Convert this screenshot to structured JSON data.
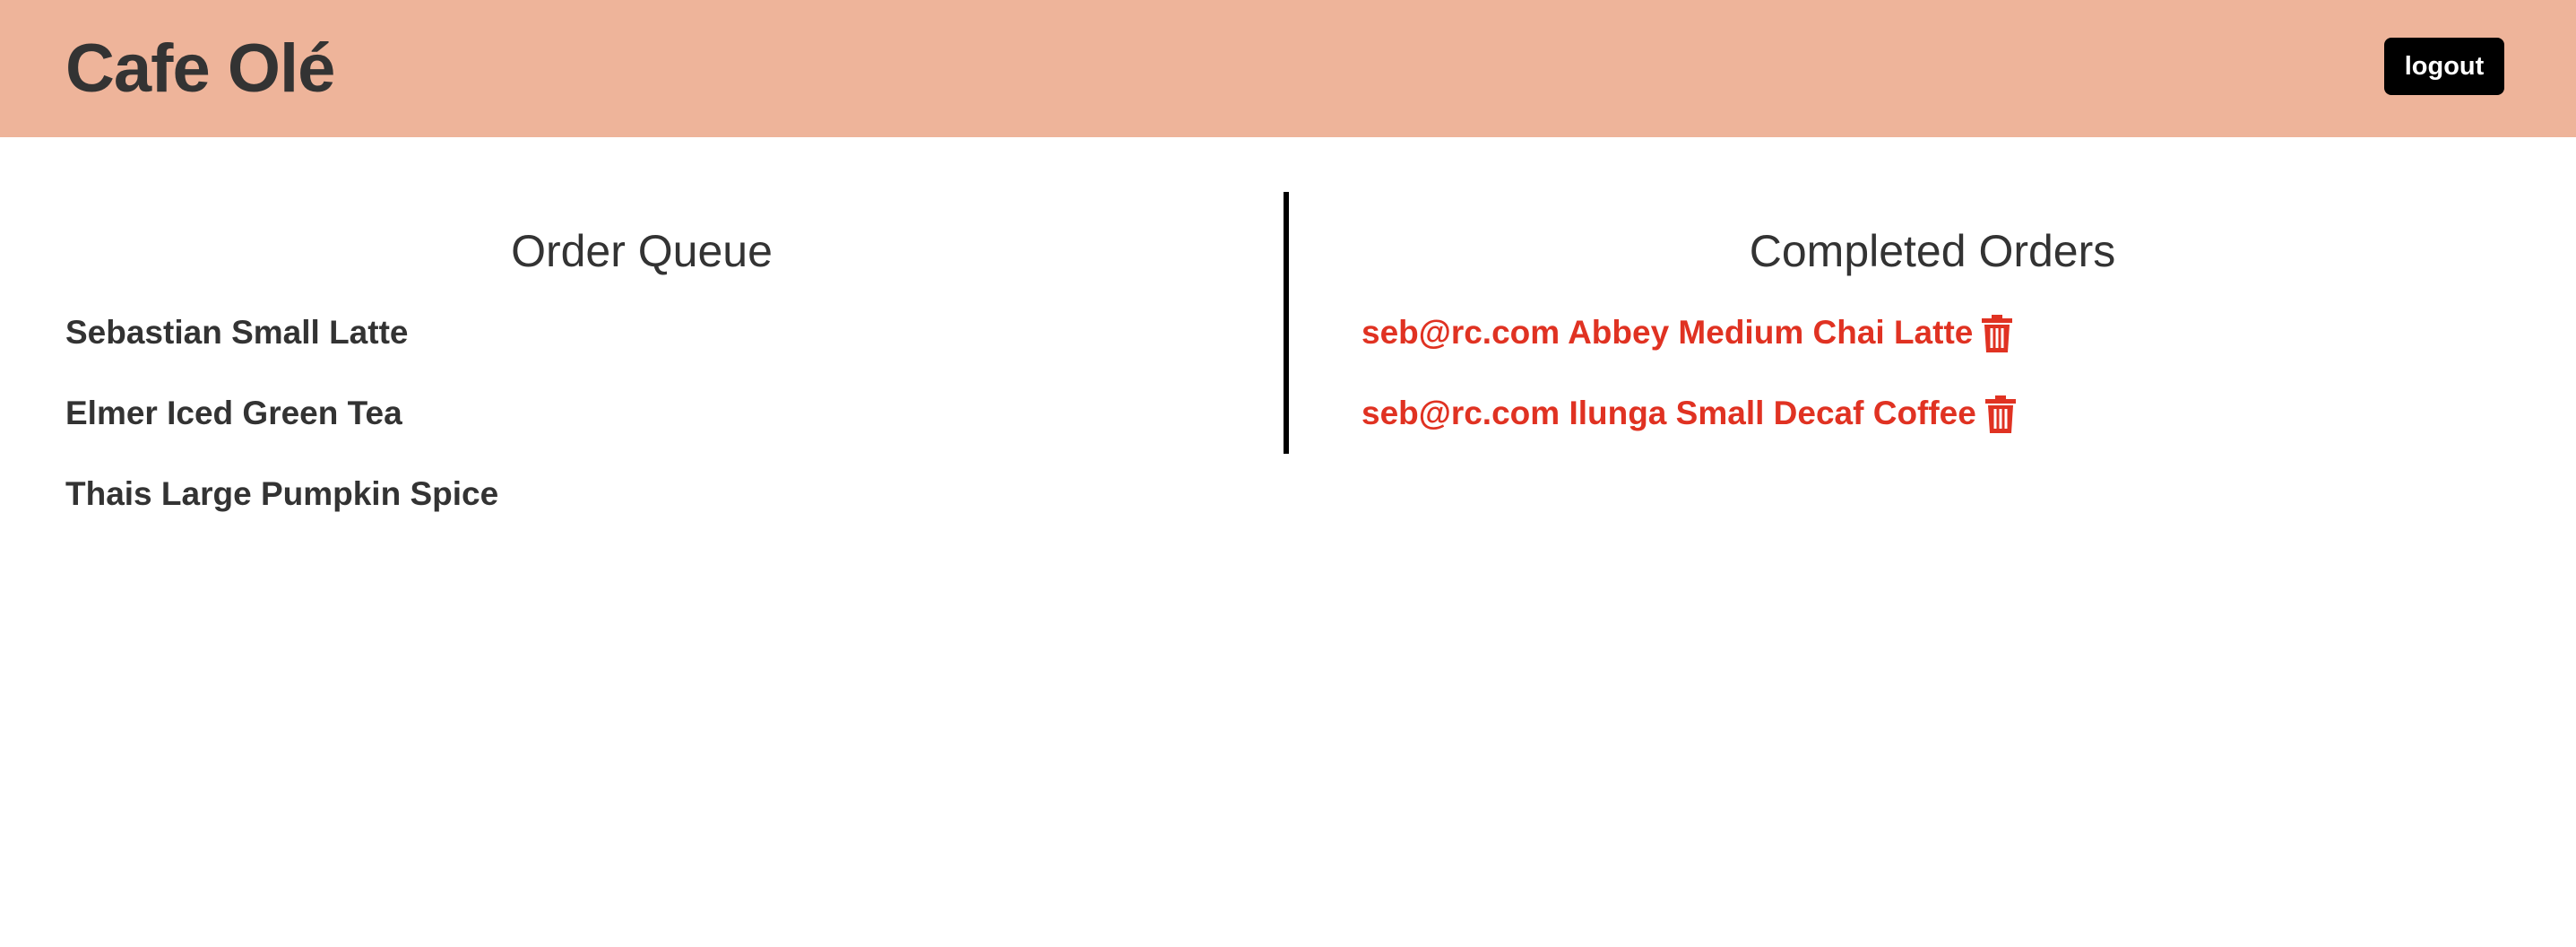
{
  "header": {
    "title": "Cafe Olé",
    "logout_label": "logout"
  },
  "queue": {
    "title": "Order Queue",
    "items": [
      {
        "text": "Sebastian Small Latte"
      },
      {
        "text": "Elmer Iced Green Tea"
      },
      {
        "text": "Thais Large Pumpkin Spice"
      }
    ]
  },
  "completed": {
    "title": "Completed Orders",
    "items": [
      {
        "text": "seb@rc.com Abbey Medium Chai Latte",
        "icon": "trash-icon"
      },
      {
        "text": "seb@rc.com Ilunga Small Decaf Coffee",
        "icon": "trash-icon"
      }
    ]
  },
  "colors": {
    "header_bg": "#eeb49a",
    "text": "#333333",
    "completed_text": "#e03222",
    "button_bg": "#000000"
  }
}
